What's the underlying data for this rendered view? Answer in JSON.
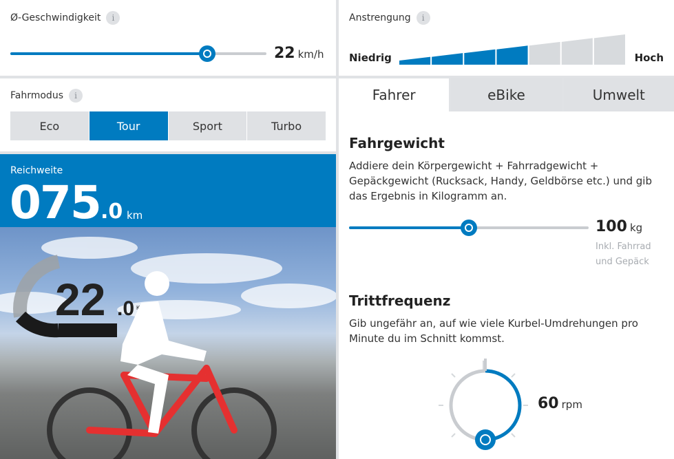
{
  "speed": {
    "label": "Ø-Geschwindigkeit",
    "info_icon": "i",
    "value": "22",
    "unit": "km/h",
    "slider_fraction": 0.77
  },
  "effort": {
    "label": "Anstrengung",
    "info_icon": "i",
    "low_label": "Niedrig",
    "high_label": "Hoch",
    "level": 4,
    "levels_total": 7
  },
  "mode": {
    "label": "Fahrmodus",
    "info_icon": "i",
    "options": [
      "Eco",
      "Tour",
      "Sport",
      "Turbo"
    ],
    "selected": "Tour"
  },
  "range": {
    "label": "Reichweite",
    "value_int": "075",
    "value_dec": ".0",
    "unit": "km"
  },
  "scene": {
    "speed_int": "22",
    "speed_dec": ".0",
    "speed_unit": "KM/H",
    "gauge_fraction": 0.62
  },
  "tabs": {
    "items": [
      "Fahrer",
      "eBike",
      "Umwelt"
    ],
    "active": "Fahrer"
  },
  "weight": {
    "title": "Fahrgewicht",
    "description": "Addiere dein Körpergewicht + Fahrradgewicht + Gepäckgewicht (Rucksack, Handy, Geldbörse etc.) und gib das Ergebnis in Kilogramm an.",
    "value": "100",
    "unit": "kg",
    "note_line1": "Inkl. Fahrrad",
    "note_line2": "und Gepäck",
    "slider_fraction": 0.5
  },
  "cadence": {
    "title": "Trittfrequenz",
    "description": "Gib ungefähr an, auf wie viele Kurbel-Umdrehungen pro Minute du im Schnitt kommst.",
    "value": "60",
    "unit": "rpm",
    "dial_fraction": 0.5
  },
  "colors": {
    "accent": "#007bc0",
    "inactive": "#dfe1e4",
    "track": "#c9ccd0"
  }
}
